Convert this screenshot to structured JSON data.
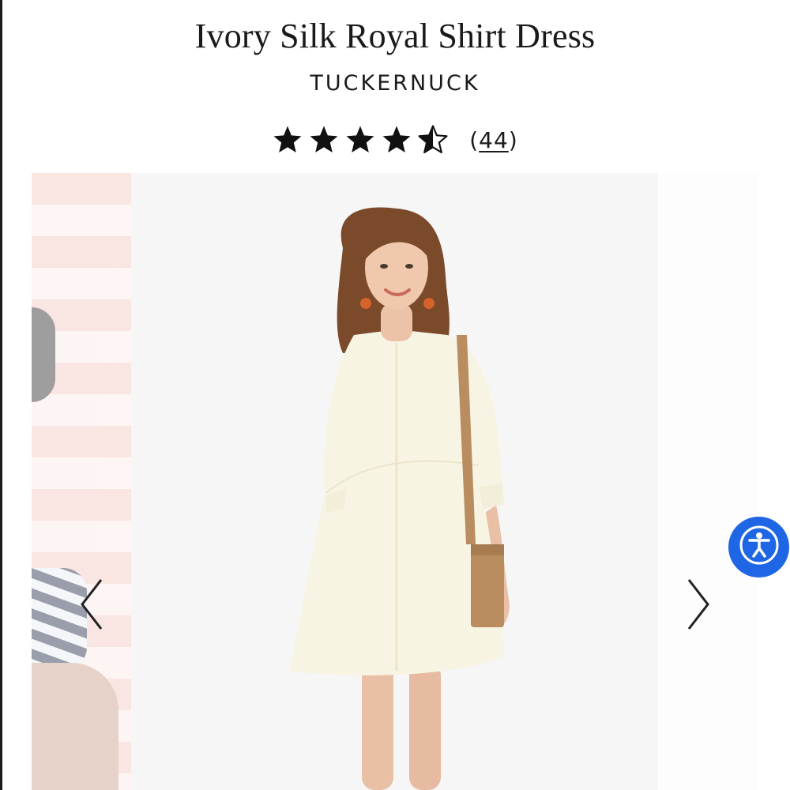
{
  "product": {
    "title": "Ivory Silk Royal Shirt Dress",
    "brand": "TUCKERNUCK",
    "rating": 4.5,
    "rating_max": 5,
    "review_count_open": "(",
    "review_count": "44",
    "review_count_close": ")"
  },
  "gallery": {
    "main_image": "model-ivory-shirt-dress-photo",
    "prev_icon": "chevron-left-icon",
    "next_icon": "chevron-right-icon"
  },
  "accessibility": {
    "icon": "accessibility-person-icon",
    "color": "#1f66e5"
  },
  "colors": {
    "dress": "#f8f4e3",
    "bag": "#b98d5f",
    "hair": "#7a4a2a",
    "background": "#f6f6f6"
  }
}
